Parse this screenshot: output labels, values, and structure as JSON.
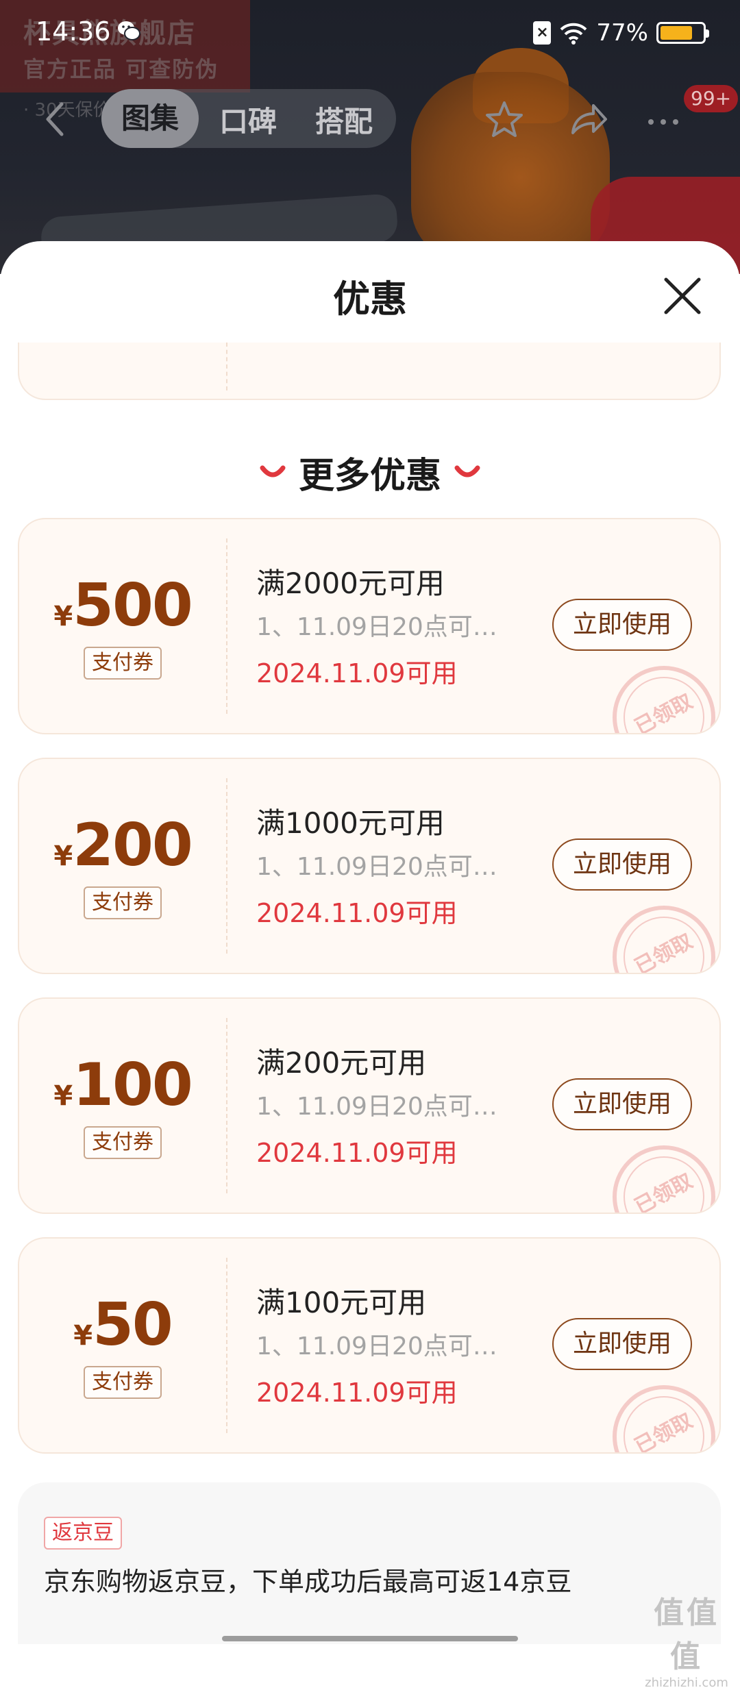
{
  "status_bar": {
    "time": "14:36",
    "battery": "77%",
    "battery_level": 0.77,
    "battery_color": "#f6b21b"
  },
  "store_banner": {
    "name": "杯具熊旗舰店",
    "sub": "官方正品  可查防伪",
    "sub2": "· 30天保价"
  },
  "navbar": {
    "tabs": [
      "图集",
      "口碑",
      "搭配"
    ],
    "active_tab": "图集",
    "more_badge": "99+"
  },
  "sheet": {
    "title": "优惠",
    "section_title": "更多优惠",
    "coupons": [
      {
        "currency": "¥",
        "amount": "500",
        "type": "支付券",
        "condition": "满2000元可用",
        "desc": "1、11.09日20点可…",
        "date": "2024.11.09可用",
        "button": "立即使用",
        "stamp": "已领取"
      },
      {
        "currency": "¥",
        "amount": "200",
        "type": "支付券",
        "condition": "满1000元可用",
        "desc": "1、11.09日20点可…",
        "date": "2024.11.09可用",
        "button": "立即使用",
        "stamp": "已领取"
      },
      {
        "currency": "¥",
        "amount": "100",
        "type": "支付券",
        "condition": "满200元可用",
        "desc": "1、11.09日20点可…",
        "date": "2024.11.09可用",
        "button": "立即使用",
        "stamp": "已领取"
      },
      {
        "currency": "¥",
        "amount": "50",
        "type": "支付券",
        "condition": "满100元可用",
        "desc": "1、11.09日20点可…",
        "date": "2024.11.09可用",
        "button": "立即使用",
        "stamp": "已领取"
      }
    ],
    "jd_bean": {
      "tag": "返京豆",
      "text": "京东购物返京豆，下单成功后最高可返14京豆"
    }
  },
  "watermark": {
    "big": "值值值",
    "small": "zhizhizhi.com"
  },
  "colors": {
    "accent_red": "#e0383e",
    "coupon_brown": "#8d3c0b",
    "coupon_bg": "#fff9f4"
  }
}
